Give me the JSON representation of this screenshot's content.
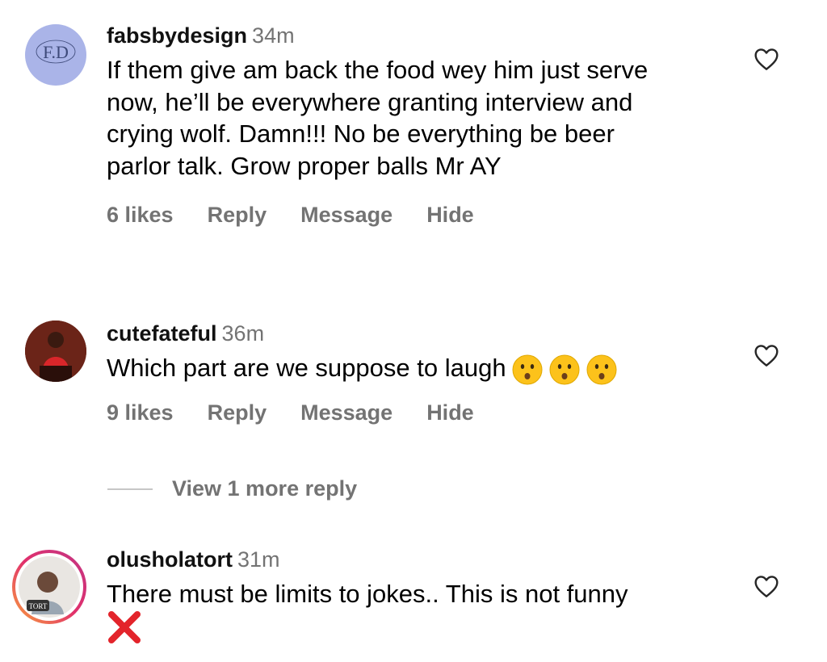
{
  "comments": [
    {
      "username": "fabsbydesign",
      "time": "34m",
      "avatar_initials": "F.D",
      "text": "If them give am back the food wey him just serve now, he’ll be everywhere granting interview and crying wolf. Damn!!! No be everything be beer parlor talk. Grow proper balls Mr AY",
      "likes": "6 likes",
      "reply": "Reply",
      "message": "Message",
      "hide": "Hide"
    },
    {
      "username": "cutefateful",
      "time": "36m",
      "text": "Which part are we suppose to laugh",
      "emoji": "hushed-face-emoji",
      "likes": "9 likes",
      "reply": "Reply",
      "message": "Message",
      "hide": "Hide"
    },
    {
      "username": "olusholatort",
      "time": "31m",
      "avatar_badge": "TORT",
      "text": "There must be limits to jokes.. This is not funny",
      "emoji": "cross-mark-emoji"
    }
  ],
  "view_more_replies": "View 1 more reply",
  "colors": {
    "secondary_text": "#737373",
    "avatar_lavender": "#aab4e8",
    "cross_red": "#e3242b",
    "story_ring": [
      "#f9a33c",
      "#e1306c",
      "#c13584"
    ]
  }
}
